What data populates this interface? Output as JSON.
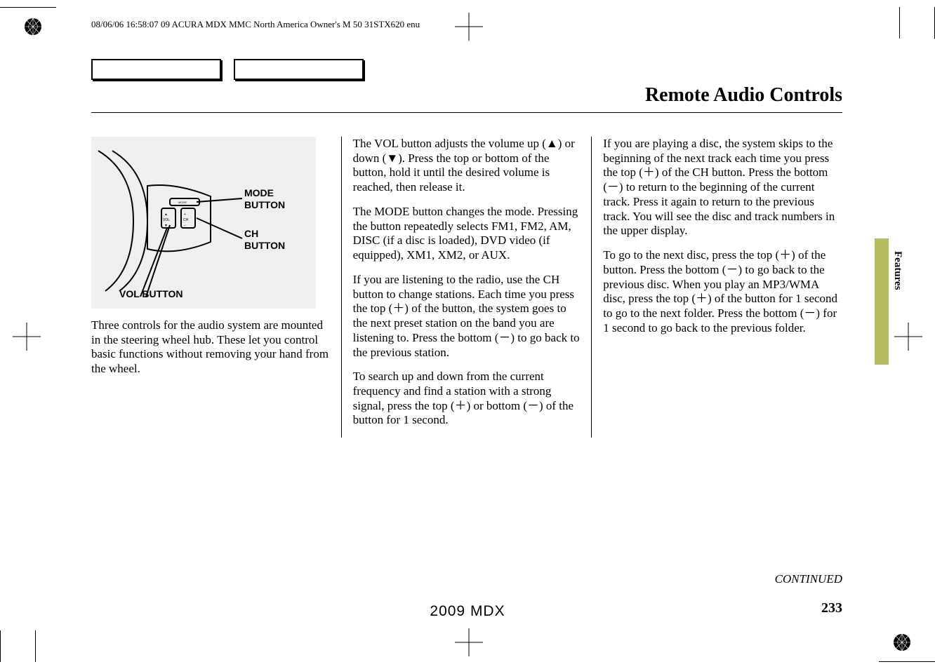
{
  "header": {
    "meta": "08/06/06 16:58:07   09 ACURA MDX MMC North America Owner's M 50 31STX620 enu"
  },
  "title": "Remote Audio Controls",
  "side_tab": "Features",
  "figure": {
    "mode_label_1": "MODE",
    "mode_label_2": "BUTTON",
    "ch_label_1": "CH",
    "ch_label_2": "BUTTON",
    "vol_label": "VOL BUTTON"
  },
  "col1": {
    "p1": "Three controls for the audio system are mounted in the steering wheel hub. These let you control basic functions without removing your hand from the wheel."
  },
  "col2": {
    "p1": "The VOL button adjusts the volume up (▲) or down (▼). Press the top or bottom of the button, hold it until the desired volume is reached, then release it.",
    "p2": "The MODE button changes the mode. Pressing the button repeatedly selects FM1, FM2, AM, DISC (if a disc is loaded), DVD video (if equipped), XM1, XM2, or AUX.",
    "p3": "If you are listening to the radio, use the CH button to change stations. Each time you press the top (＋) of the button, the system goes to the next preset station on the band you are listening to. Press the bottom (－) to go back to the previous station.",
    "p4": "To search up and down from the current frequency and find a station with a strong signal, press the top (＋) or bottom (－) of the button for 1 second."
  },
  "col3": {
    "p1": "If you are playing a disc, the system skips to the beginning of the next track each time you press the top (＋) of the CH button. Press the bottom (－) to return to the beginning of the current track. Press it again to return to the previous track. You will see the disc and track numbers in the upper display.",
    "p2": "To go to the next disc, press the top (＋) of the button. Press the bottom (－) to go back to the previous disc. When you play an MP3/WMA disc, press the top (＋) of the button for 1 second to go to the next folder. Press the bottom (－) for 1 second to go back to the previous folder."
  },
  "footer": {
    "continued": "CONTINUED",
    "page_number": "233",
    "model_year": "2009  MDX"
  }
}
